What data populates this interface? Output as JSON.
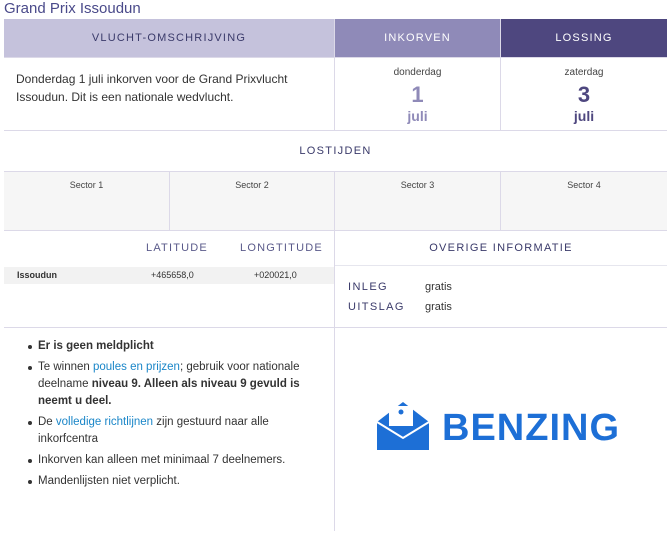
{
  "page": {
    "title": "Grand Prix Issoudun"
  },
  "header": {
    "description": "VLUCHT-OMSCHRIJVING",
    "inkorven": "INKORVEN",
    "lossing": "LOSSING"
  },
  "description": "Donderdag 1 juli inkorven voor de Grand Prixvlucht Issoudun. Dit is een nationale wedvlucht.",
  "inkorven_date": {
    "weekday": "donderdag",
    "day": "1",
    "month": "juli"
  },
  "lossing_date": {
    "weekday": "zaterdag",
    "day": "3",
    "month": "juli"
  },
  "lostijden": {
    "title": "LOSTIJDEN",
    "sectors": [
      "Sector 1",
      "Sector 2",
      "Sector 3",
      "Sector 4"
    ]
  },
  "coordinates": {
    "latitude_label": "LATITUDE",
    "longitude_label": "LONGTITUDE",
    "location": "Issoudun",
    "latitude": "+465658,0",
    "longitude": "+020021,0"
  },
  "overige": {
    "title": "OVERIGE INFORMATIE",
    "inleg_label": "INLEG",
    "inleg_value": "gratis",
    "uitslag_label": "UITSLAG",
    "uitslag_value": "gratis"
  },
  "rules": {
    "r1": "Er is geen meldplicht",
    "r2_pre": "Te winnen ",
    "r2_link": "poules en prijzen",
    "r2_mid": "; gebruik voor nationale deelname ",
    "r2_bold": "niveau 9. Alleen als niveau 9 gevuld is neemt u deel.",
    "r3_pre": "De ",
    "r3_link": "volledige richtlijnen",
    "r3_post": " zijn gestuurd naar alle inkorfcentra",
    "r4": "Inkorven kan alleen met minimaal 7 deelnemers.",
    "r5": "Mandenlijsten niet verplicht."
  },
  "logo": {
    "text": "BENZING",
    "color": "#1d6fd6"
  },
  "colors": {
    "header_light": "#c5c2dc",
    "header_mid": "#8f8ab8",
    "header_dark": "#4e477f",
    "link": "#1a86c8"
  }
}
